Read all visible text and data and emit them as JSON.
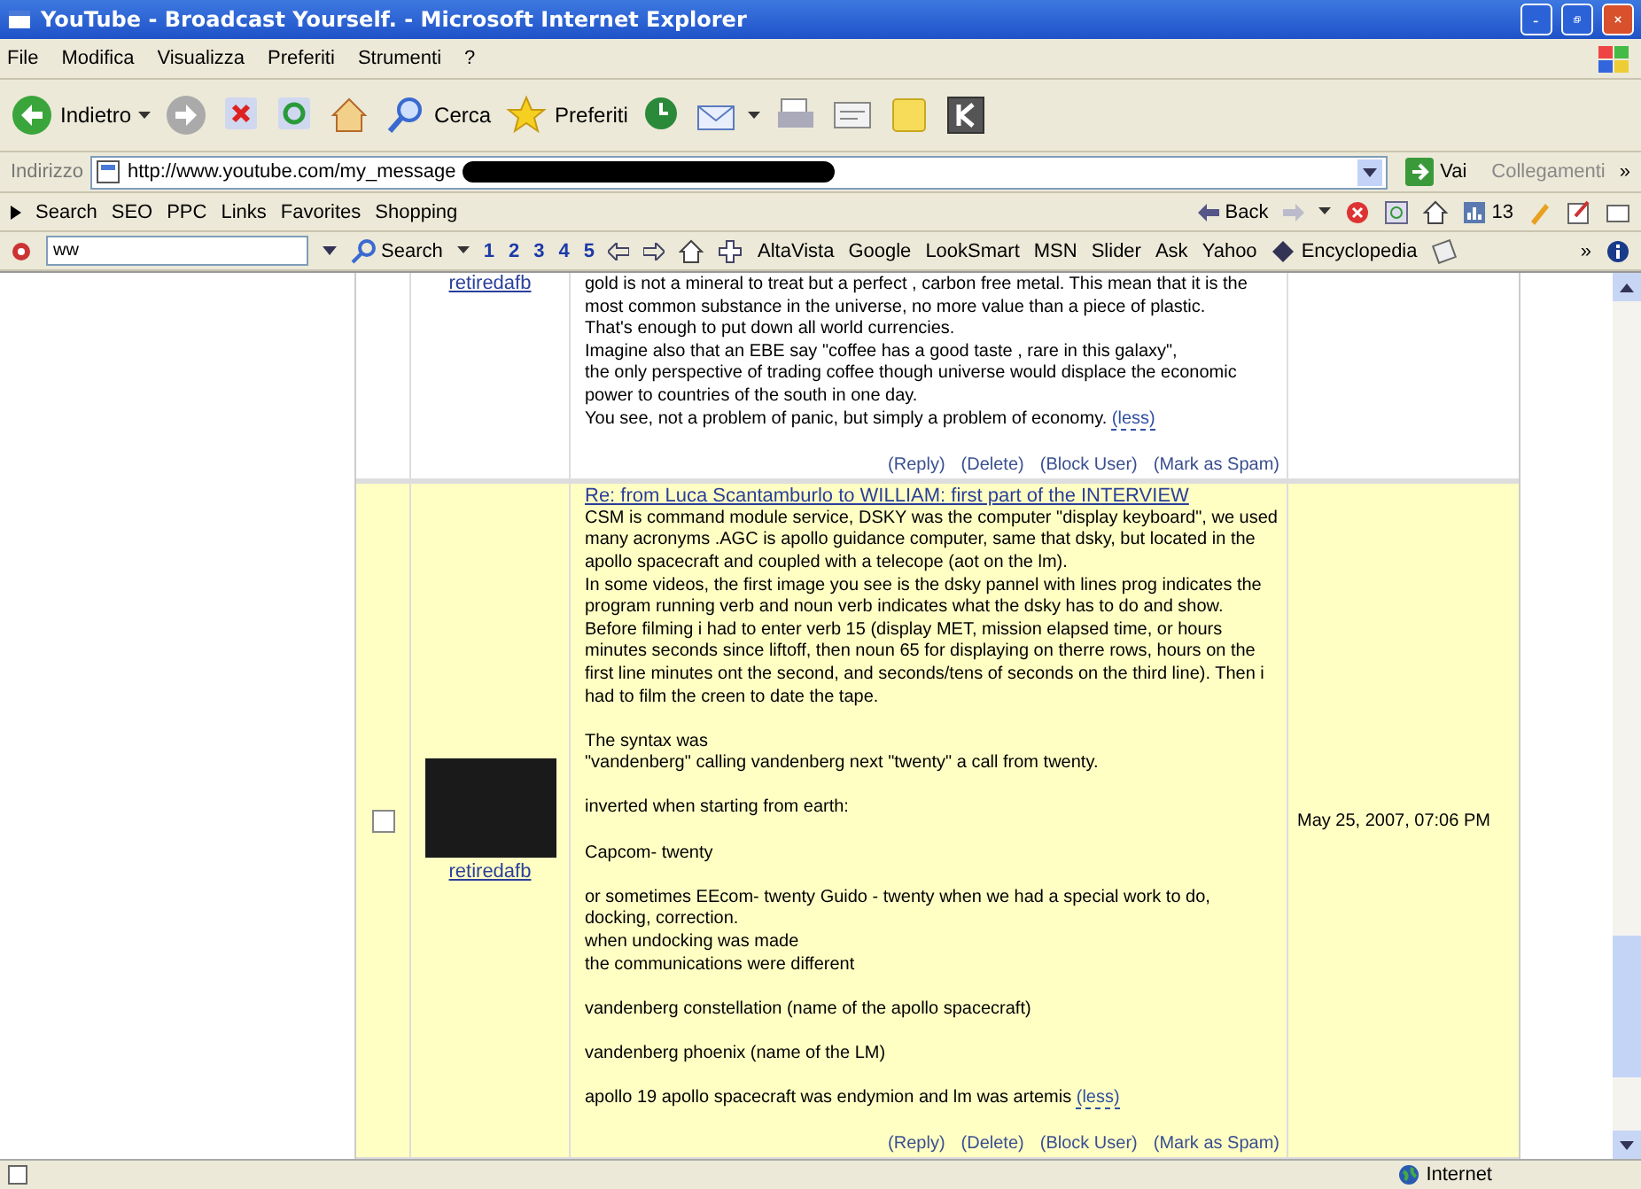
{
  "window": {
    "title": "YouTube - Broadcast Yourself. - Microsoft Internet Explorer"
  },
  "menu": [
    "File",
    "Modifica",
    "Visualizza",
    "Preferiti",
    "Strumenti",
    "?"
  ],
  "toolbar": [
    {
      "kind": "back",
      "label": "Indietro"
    },
    {
      "kind": "forward"
    },
    {
      "kind": "stop"
    },
    {
      "kind": "refresh"
    },
    {
      "kind": "home"
    },
    {
      "kind": "search",
      "label": "Cerca"
    },
    {
      "kind": "favorites",
      "label": "Preferiti"
    },
    {
      "kind": "history"
    },
    {
      "kind": "mail"
    },
    {
      "kind": "print"
    },
    {
      "kind": "edit"
    },
    {
      "kind": "note"
    },
    {
      "kind": "k"
    }
  ],
  "address": {
    "label": "Indirizzo",
    "url": "http://www.youtube.com/my_message",
    "go": "Vai",
    "links": "Collegamenti",
    "more": "»"
  },
  "links_bar": {
    "items": [
      "Search",
      "SEO",
      "PPC",
      "Links",
      "Favorites",
      "Shopping"
    ],
    "back": "Back",
    "count": "13"
  },
  "search_bar": {
    "value": "ww",
    "search": "Search",
    "numbers": [
      "1",
      "2",
      "3",
      "4",
      "5"
    ],
    "engines": [
      "AltaVista",
      "Google",
      "LookSmart",
      "MSN",
      "Slider",
      "Ask",
      "Yahoo"
    ],
    "encyclopedia": "Encyclopedia",
    "more": "»"
  },
  "messages": [
    {
      "username": "retiredafb",
      "avatar": false,
      "paragraphs": [
        "gold is not a mineral to treat but a perfect , carbon free metal. This mean that it is the most common substance in the universe, no more value than a piece of plastic.\nThat's enough to put down all world currencies.\nImagine also that an EBE say \"coffee has a good taste , rare in this galaxy\",\nthe only perspective of trading coffee though universe would displace the economic power to countries of the south in one day.\nYou see, not a problem of panic, but simply a problem of economy."
      ],
      "less": "(less)",
      "actions": [
        "(Reply)",
        "(Delete)",
        "(Block User)",
        "(Mark as Spam)"
      ],
      "highlighted": false
    },
    {
      "username": "retiredafb",
      "checked": false,
      "avatar": true,
      "subject": "Re: from Luca Scantamburlo to WILLIAM: first part of the INTERVIEW",
      "paragraphs": [
        "CSM is command module service, DSKY was the computer \"display keyboard\", we used many acronyms .AGC is apollo guidance computer, same that dsky, but located in the apollo spacecraft and coupled with a telecope (aot on the lm).\nIn some videos, the first image you see is the dsky pannel with lines prog indicates the program running verb and noun verb indicates what the dsky has to do and show.\nBefore filming i had to enter verb 15 (display MET, mission elapsed time, or hours minutes seconds since liftoff, then noun 65 for displaying on therre rows, hours on the first line minutes ont the second, and seconds/tens of seconds on the third line). Then i had to film the creen to date the tape.",
        "The syntax was\n\"vandenberg\" calling vandenberg next \"twenty\" a call from twenty.",
        "inverted when starting from earth:",
        "Capcom- twenty",
        "or sometimes EEcom- twenty Guido - twenty when we had a special work to do, docking, correction.\nwhen undocking was made\nthe communications were different",
        "vandenberg constellation (name of the apollo spacecraft)",
        "vandenberg phoenix (name of the LM)",
        "apollo 19 apollo spacecraft was endymion and lm was artemis"
      ],
      "less": "(less)",
      "actions": [
        "(Reply)",
        "(Delete)",
        "(Block User)",
        "(Mark as Spam)"
      ],
      "date": "May 25, 2007, 07:06 PM",
      "highlighted": true
    }
  ],
  "status_bar": {
    "zone": "Internet"
  }
}
